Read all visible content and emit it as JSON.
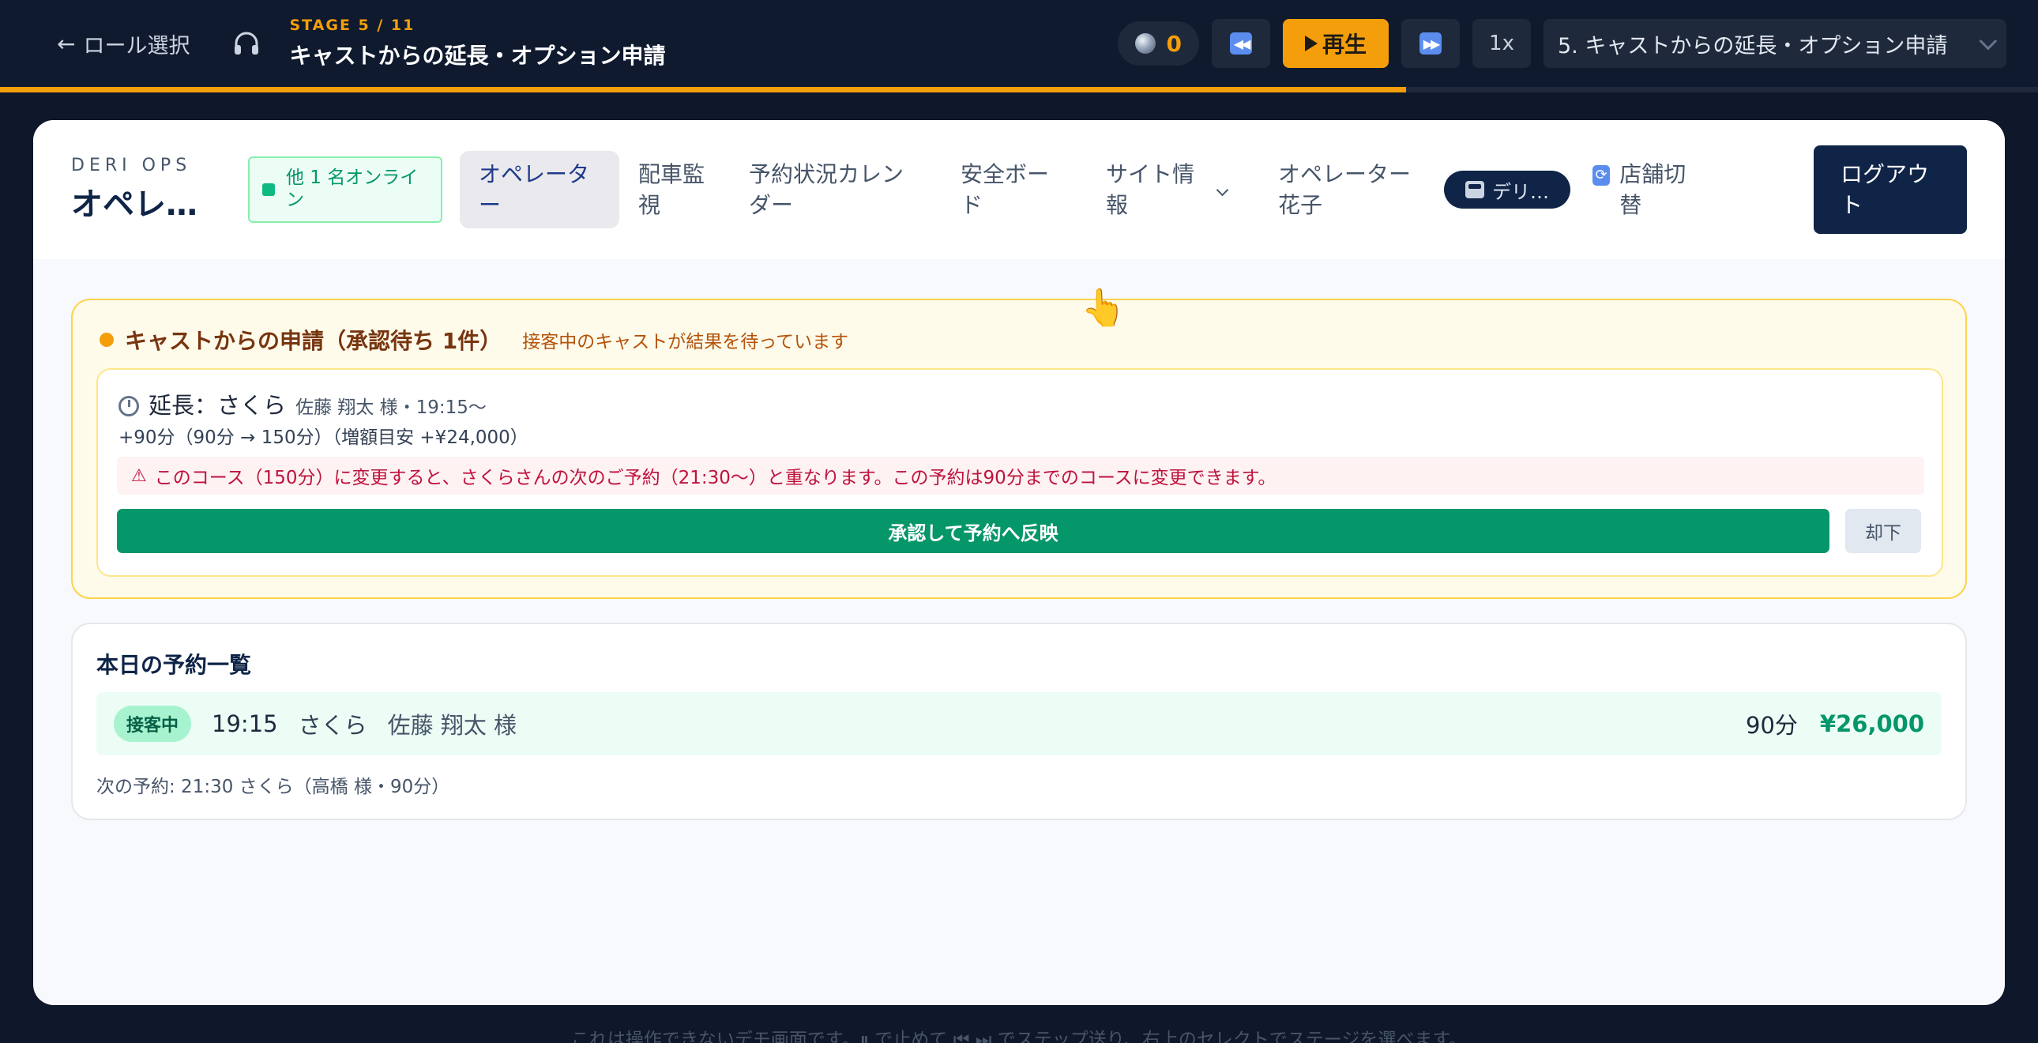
{
  "topbar": {
    "back_label": "ロール選択",
    "stage_kicker": "STAGE 5 / 11",
    "stage_title": "キャストからの延長・オプション申請",
    "counter_value": "0",
    "play_label": "再生",
    "speed_label": "1x",
    "stage_select_value": "5. キャストからの延長・オプション申請",
    "progress_fraction": 0.69
  },
  "navbar": {
    "brand_kicker": "DERI OPS",
    "brand_title": "オペレー…",
    "online_badge": "他 1 名オンライン",
    "items": [
      {
        "label": "オペレーター",
        "active": true
      },
      {
        "label": "配車監視",
        "active": false
      },
      {
        "label": "予約状況カレンダー",
        "active": false
      },
      {
        "label": "安全ボード",
        "active": false
      },
      {
        "label": "サイト情報",
        "active": false,
        "has_dropdown": true
      },
      {
        "label": "オペレーター 花子",
        "active": false
      }
    ],
    "brand_chip": "デリ…",
    "switch_store": "店舗切替",
    "logout": "ログアウト"
  },
  "request": {
    "title": "キャストからの申請（承認待ち 1件）",
    "subtitle": "接客中のキャストが結果を待っています",
    "ext_label": "延長：さくら",
    "ext_meta": "佐藤 翔太 様・19:15〜",
    "detail": "+90分（90分 → 150分）（増額目安 +¥24,000）",
    "warning": "このコース（150分）に変更すると、さくらさんの次のご予約（21:30〜）と重なります。この予約は90分までのコースに変更できます。",
    "approve_label": "承認して予約へ反映",
    "reject_label": "却下"
  },
  "today": {
    "title": "本日の予約一覧",
    "row": {
      "status": "接客中",
      "time": "19:15",
      "cast": "さくら",
      "customer": "佐藤 翔太 様",
      "duration": "90分",
      "price": "¥26,000"
    },
    "next": "次の予約: 21:30 さくら（高橋 様・90分）"
  },
  "footer": {
    "hint": "これは操作できないデモ画面です。⏸ で止めて ⏮ ⏭ でステップ送り、右上のセレクトでステージを選べます。"
  },
  "colors": {
    "accent": "#f59e0b",
    "navy": "#0f2447",
    "success": "#059669",
    "danger": "#be123c"
  }
}
